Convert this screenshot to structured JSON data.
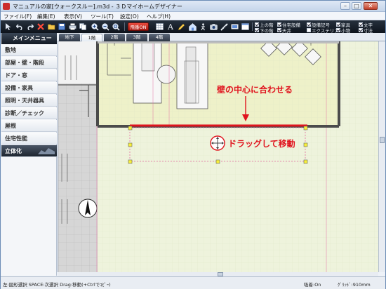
{
  "window": {
    "title": "マニュアルの家[ウォークスルー].m3d - ３Ｄマイホームデザイナー",
    "minimize_glyph": "–",
    "maximize_glyph": "□",
    "close_glyph": "✕"
  },
  "menubar": {
    "items": [
      "ファイル(F)",
      "編集(E)",
      "表示(V)",
      "ツール(T)",
      "設定(O)",
      "ヘルプ(H)"
    ]
  },
  "toolbar": {
    "kaibei_label": "飛番ON",
    "checks_top": [
      {
        "label": "上の階",
        "checked": true
      },
      {
        "label": "住宅設備",
        "checked": true
      },
      {
        "label": "設備記号",
        "checked": true
      },
      {
        "label": "家具",
        "checked": true
      },
      {
        "label": "文字",
        "checked": true
      }
    ],
    "checks_bottom": [
      {
        "label": "下の階",
        "checked": true
      },
      {
        "label": "天井",
        "checked": true
      },
      {
        "label": "エクステリア",
        "checked": false
      },
      {
        "label": "小物",
        "checked": true
      },
      {
        "label": "寸法",
        "checked": true
      }
    ]
  },
  "sidebar": {
    "title": "メインメニュー",
    "items": [
      {
        "label": "敷地"
      },
      {
        "label": "部屋・壁・階段"
      },
      {
        "label": "ドア・窓"
      },
      {
        "label": "設備・家具"
      },
      {
        "label": "照明・天井器具"
      },
      {
        "label": "診断／チェック"
      },
      {
        "label": "屋根"
      },
      {
        "label": "住宅性能"
      },
      {
        "label": "立体化"
      }
    ]
  },
  "floor_tabs": {
    "tabs": [
      "地下",
      "1階",
      "2階",
      "3階",
      "4階"
    ],
    "active_index": 1
  },
  "canvas": {
    "annotation_top": "壁の中心に合わせる",
    "annotation_drag": "ドラッグして移動",
    "annotation_color": "#e0141e",
    "selection_color": "#e0141e"
  },
  "statusbar": {
    "left": "左:図形選択 SPACE:次選択 Drag:移動(+Ctrlでｺﾋﾟｰ)",
    "snap": "吸着:On",
    "grid": "ｸﾞﾘｯﾄﾞ:910mm"
  }
}
